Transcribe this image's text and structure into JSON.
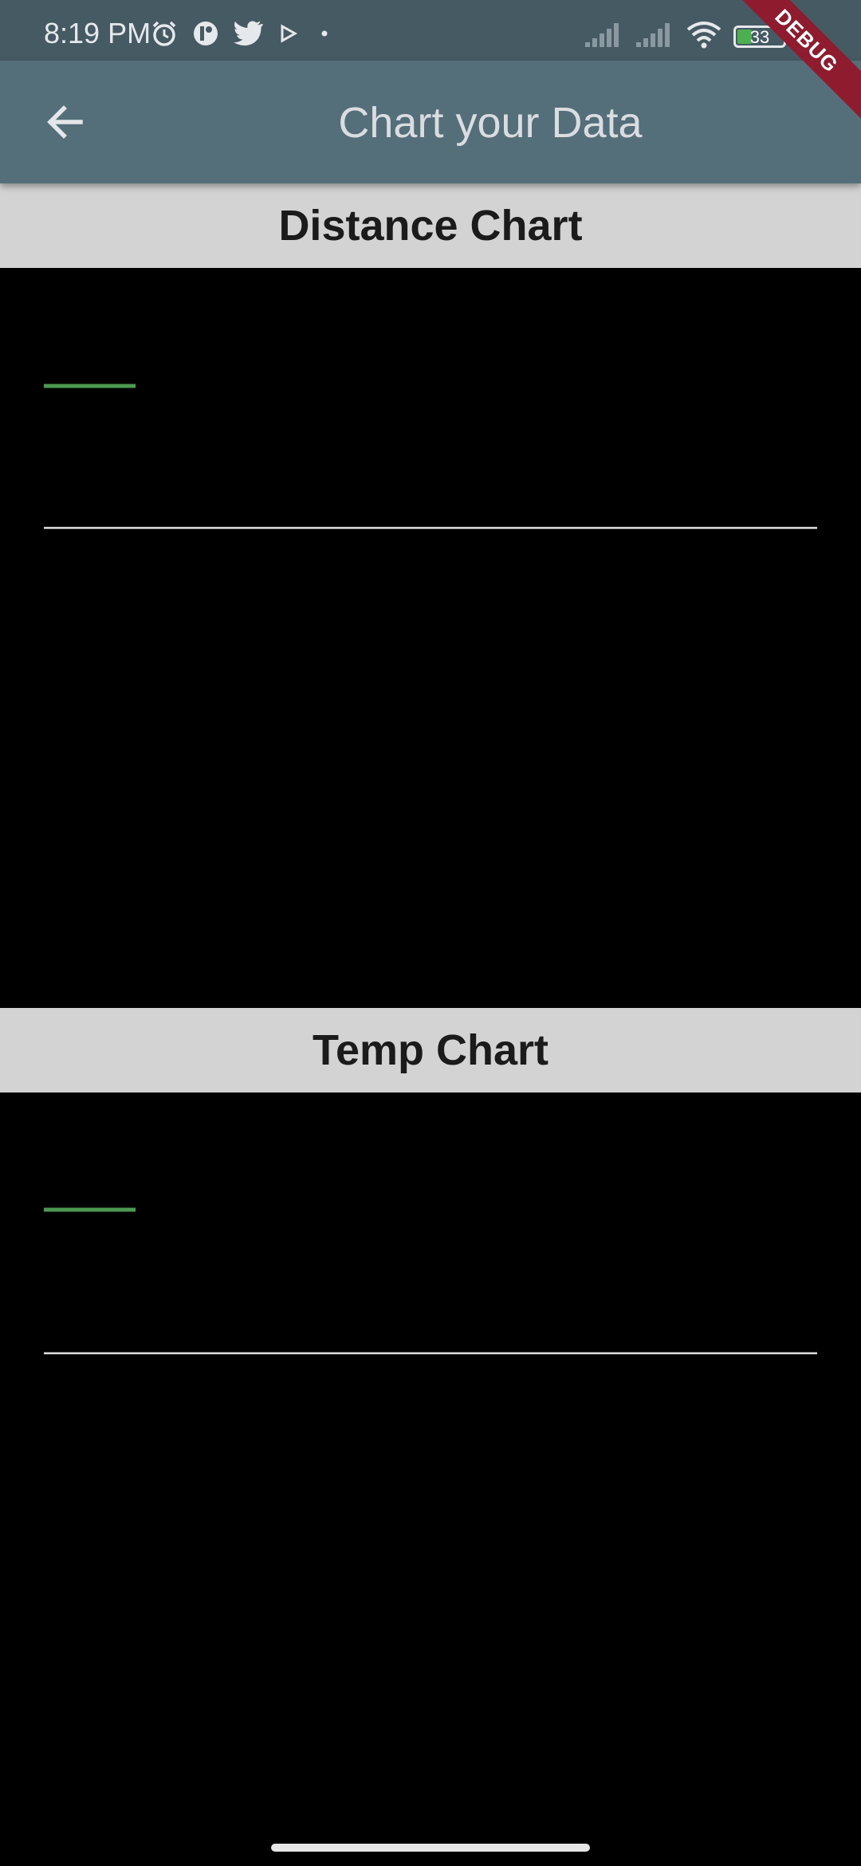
{
  "status_bar": {
    "time": "8:19 PM",
    "battery_level": "33",
    "left_icons": [
      "alarm-icon",
      "app-notification-icon",
      "twitter-icon",
      "play-icon",
      "dot-icon"
    ],
    "right_icons": [
      "signal-icon",
      "signal-icon",
      "wifi-icon",
      "battery-icon",
      "charging-icon"
    ]
  },
  "app_bar": {
    "title": "Chart your Data",
    "back_icon": "arrow-back-icon",
    "background": "#546e7a"
  },
  "debug_banner": {
    "label": "DEBUG"
  },
  "sections": [
    {
      "title": "Distance Chart"
    },
    {
      "title": "Temp Chart"
    }
  ],
  "chart_data": [
    {
      "type": "line",
      "title": "Distance Chart",
      "legend_placement": "top-left",
      "series": [
        {
          "color": "#4c9a52",
          "values": []
        }
      ],
      "grid": false,
      "axis_line_color": "#e0e0e0"
    },
    {
      "type": "line",
      "title": "Temp Chart",
      "legend_placement": "top-left",
      "series": [
        {
          "color": "#4c9a52",
          "values": []
        }
      ],
      "grid": false,
      "axis_line_color": "#e0e0e0"
    }
  ]
}
